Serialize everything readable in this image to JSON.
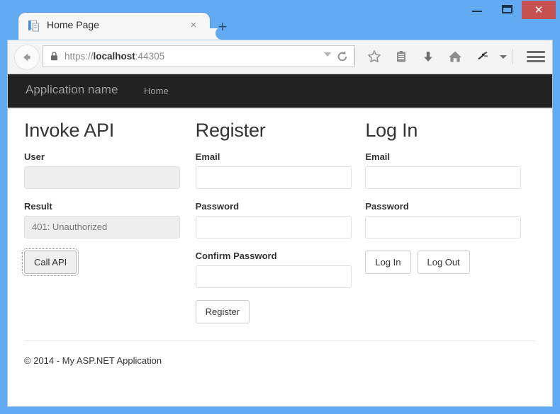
{
  "window": {
    "controls": {
      "minimize": "minimize-button",
      "maximize": "maximize-button",
      "close_label": "✕"
    },
    "frame_color": "#62aaf2"
  },
  "browser": {
    "tab": {
      "title": "Home Page",
      "close_label": "×",
      "favicon": "page-document-icon"
    },
    "new_tab_label": "+",
    "address": {
      "scheme": "https://",
      "host": "localhost",
      "port": ":44305",
      "lock_icon": "lock-icon",
      "dropdown_icon": "chevron-down-icon",
      "reload_icon": "reload-icon"
    },
    "back_icon": "back-arrow-icon",
    "toolbar_icons": [
      "star-icon",
      "reading-list-icon",
      "download-icon",
      "home-icon",
      "pocket-icon",
      "chevron-down-icon"
    ],
    "menu_icon": "hamburger-menu-icon"
  },
  "navbar": {
    "brand": "Application name",
    "links": [
      {
        "label": "Home"
      }
    ],
    "background": "#222222"
  },
  "main": {
    "columns": [
      {
        "title": "Invoke API",
        "fields": [
          {
            "label": "User",
            "value": "",
            "state": "disabled"
          },
          {
            "label": "Result",
            "value": "401: Unauthorized",
            "state": "readonly"
          }
        ],
        "buttons": [
          {
            "label": "Call API",
            "style": "focused-grey"
          }
        ]
      },
      {
        "title": "Register",
        "fields": [
          {
            "label": "Email",
            "value": "",
            "state": "normal"
          },
          {
            "label": "Password",
            "value": "",
            "state": "normal"
          },
          {
            "label": "Confirm Password",
            "value": "",
            "state": "normal"
          }
        ],
        "buttons": [
          {
            "label": "Register",
            "style": "default"
          }
        ]
      },
      {
        "title": "Log In",
        "fields": [
          {
            "label": "Email",
            "value": "",
            "state": "normal"
          },
          {
            "label": "Password",
            "value": "",
            "state": "normal"
          }
        ],
        "buttons": [
          {
            "label": "Log In",
            "style": "default"
          },
          {
            "label": "Log Out",
            "style": "default"
          }
        ]
      }
    ]
  },
  "footer": {
    "text": "© 2014 - My ASP.NET Application"
  }
}
